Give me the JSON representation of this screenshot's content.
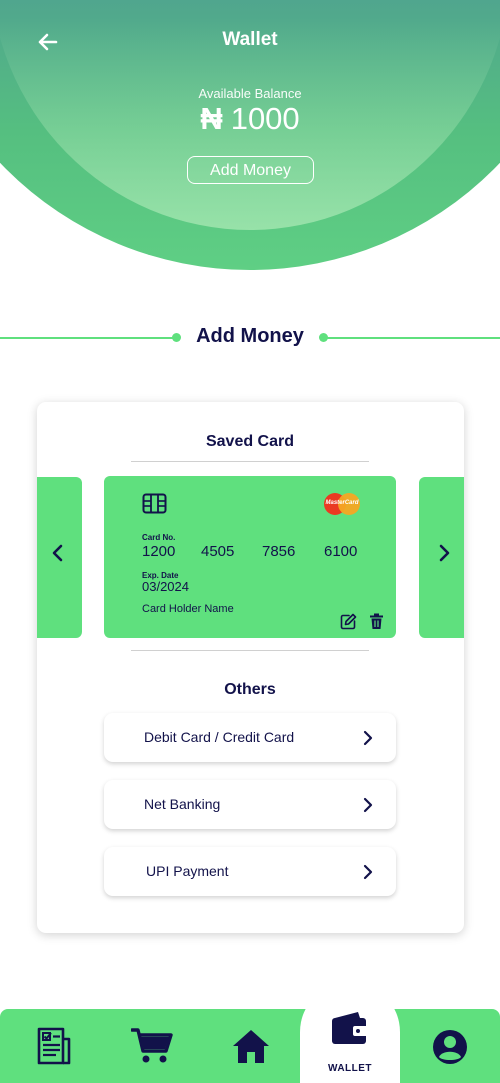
{
  "header": {
    "title": "Wallet",
    "balance_label": "Available Balance",
    "currency_symbol": "₦",
    "balance_amount": "1000",
    "add_money_button": "Add Money"
  },
  "section": {
    "title": "Add Money"
  },
  "saved_card": {
    "heading": "Saved Card",
    "card_no_label": "Card No.",
    "card_number_groups": [
      "1200",
      "4505",
      "7856",
      "6100"
    ],
    "exp_label": "Exp. Date",
    "exp_value": "03/2024",
    "holder_name": "Card Holder Name",
    "brand": "MasterCard"
  },
  "others": {
    "heading": "Others",
    "options": [
      {
        "label": "Debit Card / Credit Card"
      },
      {
        "label": "Net Banking"
      },
      {
        "label": "UPI Payment"
      }
    ]
  },
  "bottom_nav": {
    "items": [
      {
        "icon": "receipt-icon"
      },
      {
        "icon": "cart-icon"
      },
      {
        "icon": "home-icon"
      },
      {
        "icon": "wallet-icon",
        "label": "WALLET",
        "active": true
      },
      {
        "icon": "profile-icon"
      }
    ]
  },
  "colors": {
    "accent": "#5fe07e",
    "dark_text": "#12124a",
    "header_top": "#4762ae",
    "header_bottom": "#5fcf84"
  }
}
